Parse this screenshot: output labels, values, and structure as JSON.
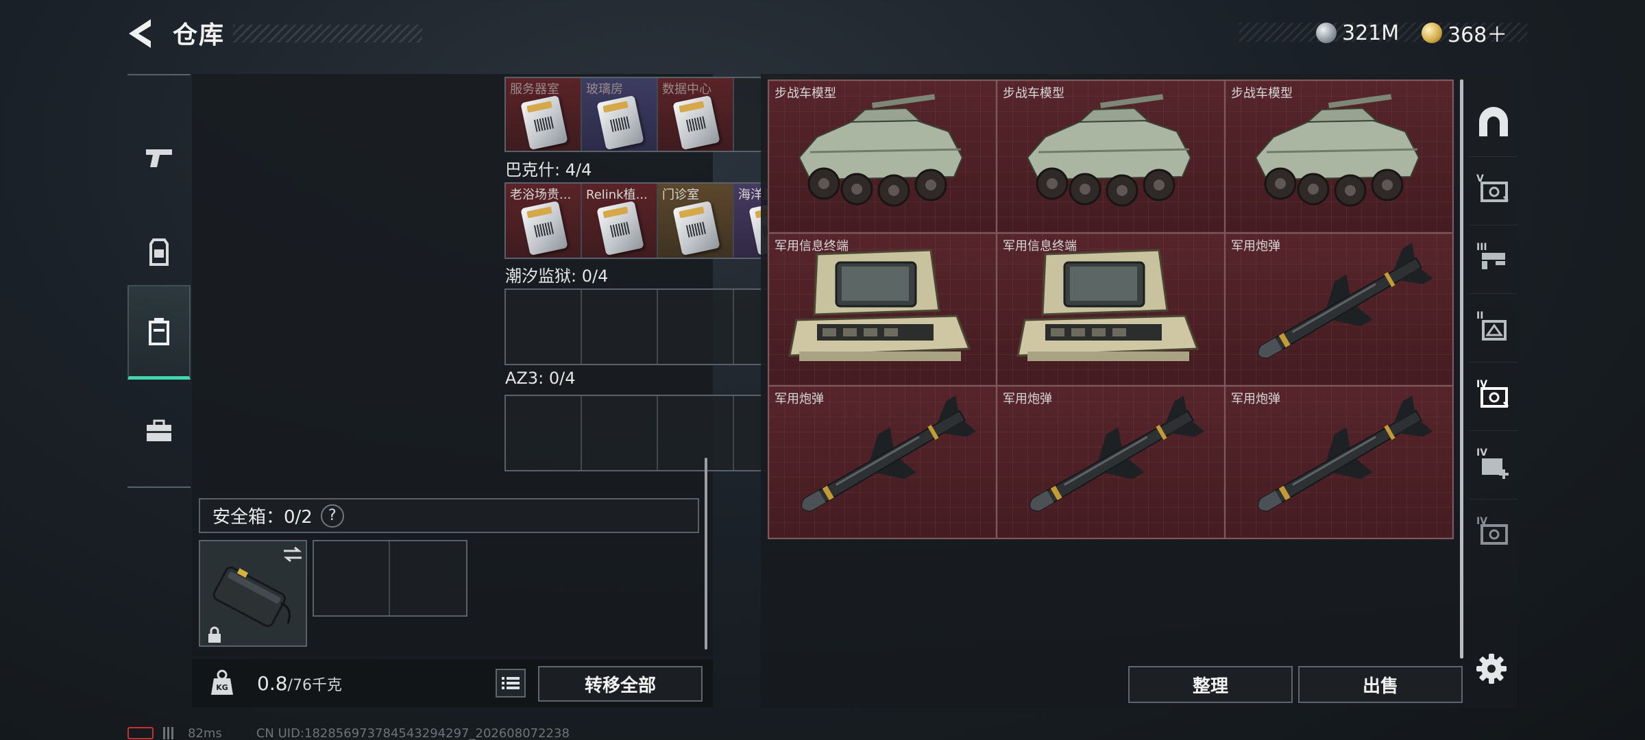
{
  "header": {
    "title": "仓库",
    "currencies": [
      {
        "icon": "silver-coin-icon",
        "amount": "321M"
      },
      {
        "icon": "gold-coin-icon",
        "amount": "368＋"
      }
    ]
  },
  "left_rail": {
    "items": [
      {
        "icon": "pistol-icon",
        "active": false
      },
      {
        "icon": "armor-vest-icon",
        "active": false
      },
      {
        "icon": "container-icon",
        "active": true
      },
      {
        "icon": "briefcase-icon",
        "active": false
      }
    ]
  },
  "storage": {
    "rows": [
      {
        "label": null,
        "slots": [
          {
            "name": "服务器室",
            "color": "red"
          },
          {
            "name": "玻璃房",
            "color": "blue"
          },
          {
            "name": "数据中心",
            "color": "red"
          },
          {
            "name": "",
            "color": "empty"
          }
        ]
      },
      {
        "label": "巴克什: 4/4",
        "slots": [
          {
            "name": "老浴场贵...",
            "color": "red"
          },
          {
            "name": "Relink植...",
            "color": "red"
          },
          {
            "name": "门诊室",
            "color": "gold"
          },
          {
            "name": "海洋监测厅",
            "color": "purple"
          }
        ]
      },
      {
        "label": "潮汐监狱: 0/4",
        "slots": [
          {
            "name": "",
            "color": "empty"
          },
          {
            "name": "",
            "color": "empty"
          },
          {
            "name": "",
            "color": "empty"
          },
          {
            "name": "",
            "color": "empty"
          }
        ]
      },
      {
        "label": "AZ3: 0/4",
        "slots": [
          {
            "name": "",
            "color": "empty"
          },
          {
            "name": "",
            "color": "empty"
          },
          {
            "name": "",
            "color": "empty"
          },
          {
            "name": "",
            "color": "empty"
          }
        ]
      }
    ],
    "safe_box": {
      "label": "安全箱：0/2",
      "help": "?"
    },
    "weight": {
      "current": "0.8",
      "capacity": "/76千克",
      "icon_text": "KG"
    },
    "transfer_all": "转移全部"
  },
  "stash": {
    "items": [
      {
        "name": "步战车模型",
        "art": "ifv"
      },
      {
        "name": "步战车模型",
        "art": "ifv"
      },
      {
        "name": "步战车模型",
        "art": "ifv"
      },
      {
        "name": "军用信息终端",
        "art": "terminal"
      },
      {
        "name": "军用信息终端",
        "art": "terminal"
      },
      {
        "name": "军用炮弹",
        "art": "missile"
      },
      {
        "name": "军用炮弹",
        "art": "missile"
      },
      {
        "name": "军用炮弹",
        "art": "missile"
      },
      {
        "name": "军用炮弹",
        "art": "missile"
      }
    ],
    "sort": "整理",
    "sell": "出售"
  },
  "right_rail": {
    "items": [
      {
        "icon": "arch-icon",
        "tier": ""
      },
      {
        "icon": "safe-v-icon",
        "tier": "V"
      },
      {
        "icon": "crate-iii-icon",
        "tier": "III"
      },
      {
        "icon": "crate-ii-icon",
        "tier": "II"
      },
      {
        "icon": "safe-iv-icon",
        "tier": "IV"
      },
      {
        "icon": "medkit-iv-icon",
        "tier": "IV"
      },
      {
        "icon": "safe-iv-b-icon",
        "tier": "IV"
      }
    ]
  },
  "status": {
    "ping": "82ms",
    "uid": "CN UID:1828569737845432942​97_202608072238"
  },
  "colors": {
    "accent": "#42d6b0",
    "item_bg": "#4f2227",
    "panel_bg": "#1a1e22"
  }
}
